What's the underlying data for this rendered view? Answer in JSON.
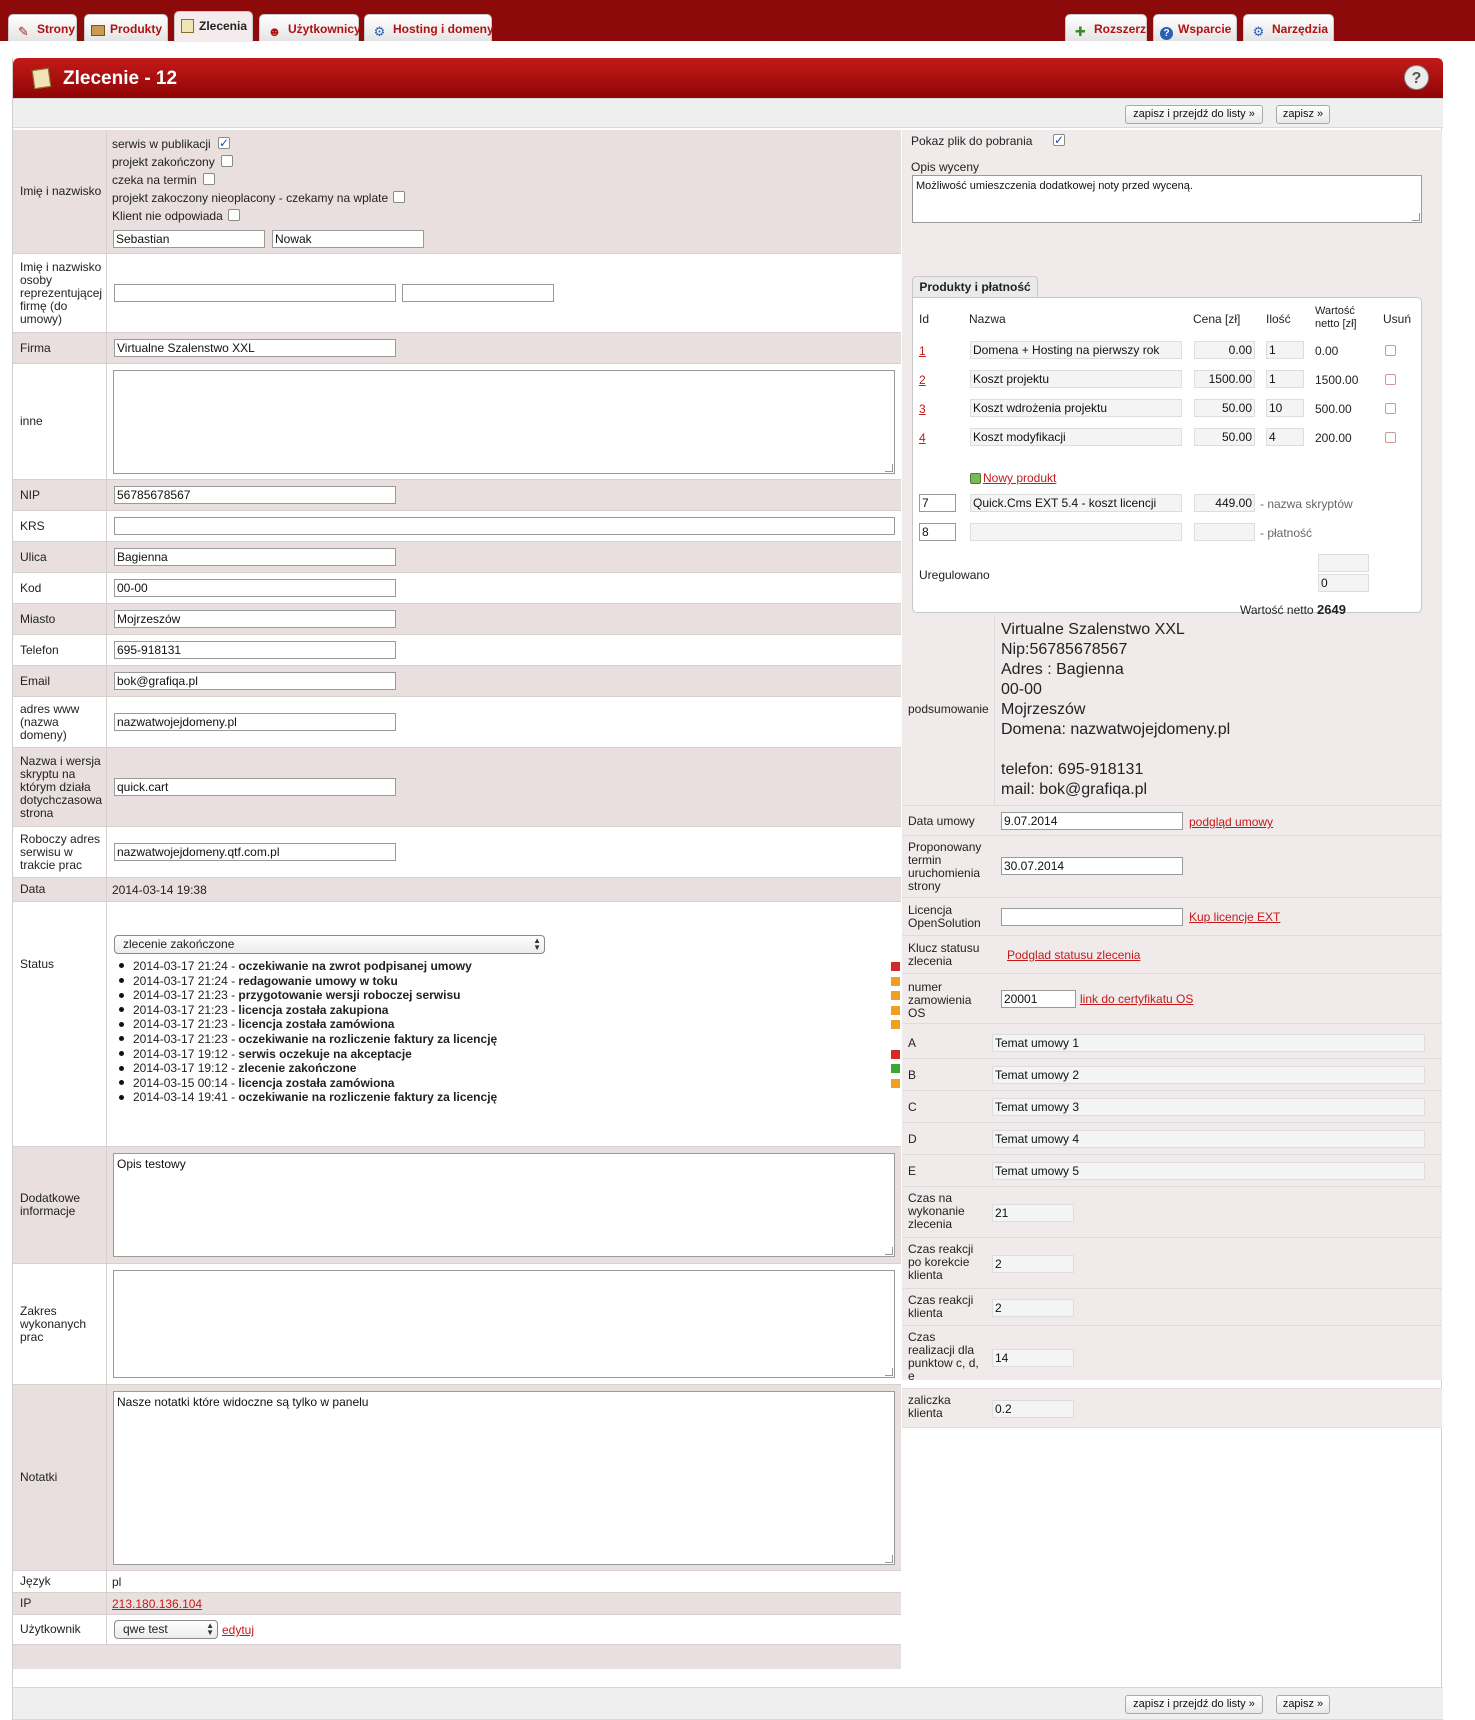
{
  "nav": {
    "tabs_left": [
      {
        "label": "Strony",
        "icon": "pencil-icon"
      },
      {
        "label": "Produkty",
        "icon": "box-icon"
      },
      {
        "label": "Zlecenia",
        "icon": "clipboard-icon"
      },
      {
        "label": "Użytkownicy",
        "icon": "user-icon"
      },
      {
        "label": "Hosting i domeny",
        "icon": "gears-icon"
      }
    ],
    "tabs_right": [
      {
        "label": "Rozszerz",
        "icon": "puzzle-icon"
      },
      {
        "label": "Wsparcie",
        "icon": "help-icon"
      },
      {
        "label": "Narzędzia",
        "icon": "gears-icon"
      }
    ],
    "active_tab": "Zlecenia"
  },
  "page": {
    "title": "Zlecenie - 12",
    "save_and_list": "zapisz i przejdź do listy »",
    "save": "zapisz »"
  },
  "left": {
    "name_label": "Imię i nazwisko",
    "checks": [
      {
        "label": "serwis w publikacji",
        "checked": true
      },
      {
        "label": "projekt zakończony",
        "checked": false
      },
      {
        "label": "czeka na termin",
        "checked": false
      },
      {
        "label": "projekt zakoczony nieoplacony - czekamy na wplate",
        "checked": false
      },
      {
        "label": "Klient nie odpowiada",
        "checked": false
      }
    ],
    "first_name": "Sebastian",
    "last_name": "Nowak",
    "rep_label": "Imię i nazwisko osoby reprezentującej firmę (do umowy)",
    "firma_label": "Firma",
    "firma": "Virtualne Szalenstwo XXL",
    "inne_label": "inne",
    "nip_label": "NIP",
    "nip": "56785678567",
    "krs_label": "KRS",
    "ulica_label": "Ulica",
    "ulica": "Bagienna",
    "kod_label": "Kod",
    "kod": "00-00",
    "miasto_label": "Miasto",
    "miasto": "Mojrzeszów",
    "telefon_label": "Telefon",
    "telefon": "695-918131",
    "email_label": "Email",
    "email": "bok@grafiqa.pl",
    "www_label": "adres www (nazwa domeny)",
    "www": "nazwatwojejdomeny.pl",
    "script_label": "Nazwa i wersja skryptu na którym działa dotychczasowa strona",
    "script": "quick.cart",
    "work_url_label": "Roboczy adres serwisu w trakcie prac",
    "work_url": "nazwatwojejdomeny.qtf.com.pl",
    "data_label": "Data",
    "data": "2014-03-14 19:38",
    "status_label": "Status",
    "status_value": "zlecenie zakończone",
    "status_history": [
      {
        "date": "2014-03-17 21:24",
        "text": "oczekiwanie na zwrot podpisanej umowy",
        "color": "#d42a2a"
      },
      {
        "date": "2014-03-17 21:24",
        "text": "redagowanie umowy w toku",
        "color": "#f0a020"
      },
      {
        "date": "2014-03-17 21:23",
        "text": "przygotowanie wersji roboczej serwisu",
        "color": "#f0a020"
      },
      {
        "date": "2014-03-17 21:23",
        "text": "licencja została zakupiona",
        "color": "#f0a020"
      },
      {
        "date": "2014-03-17 21:23",
        "text": "licencja została zamówiona",
        "color": "#f0a020"
      },
      {
        "date": "2014-03-17 21:23",
        "text": "oczekiwanie na rozliczenie faktury za licencję",
        "color": ""
      },
      {
        "date": "2014-03-17 19:12",
        "text": "serwis oczekuje na akceptacje",
        "color": "#d42a2a"
      },
      {
        "date": "2014-03-17 19:12",
        "text": "zlecenie zakończone",
        "color": "#3aa832"
      },
      {
        "date": "2014-03-15 00:14",
        "text": "licencja została zamówiona",
        "color": "#f0a020"
      },
      {
        "date": "2014-03-14 19:41",
        "text": "oczekiwanie na rozliczenie faktury za licencję",
        "color": ""
      }
    ],
    "extra_label": "Dodatkowe informacje",
    "extra": "Opis testowy",
    "scope_label": "Zakres wykonanych prac",
    "notes_label": "Notatki",
    "notes": "Nasze notatki które widoczne są tylko w panelu",
    "lang_label": "Język",
    "lang": "pl",
    "ip_label": "IP",
    "ip": "213.180.136.104",
    "user_label": "Użytkownik",
    "user": "qwe test",
    "edit": "edytuj"
  },
  "right": {
    "show_file_label": "Pokaz plik do pobrania",
    "show_file_checked": true,
    "valuation_label": "Opis wyceny",
    "valuation": "Możliwość umieszczenia dodatkowej noty przed wyceną.",
    "products_tab": "Produkty i płatność",
    "cols": {
      "id": "Id",
      "name": "Nazwa",
      "price": "Cena [zł]",
      "qty": "Ilość",
      "net": "Wartość netto [zł]",
      "del": "Usuń"
    },
    "products": [
      {
        "id": "1",
        "name": "Domena + Hosting  na pierwszy rok",
        "price": "0.00",
        "qty": "1",
        "net": "0.00"
      },
      {
        "id": "2",
        "name": "Koszt projektu",
        "price": "1500.00",
        "qty": "1",
        "net": "1500.00"
      },
      {
        "id": "3",
        "name": "Koszt wdrożenia projektu",
        "price": "50.00",
        "qty": "10",
        "net": "500.00"
      },
      {
        "id": "4",
        "name": "Koszt modyfikacji",
        "price": "50.00",
        "qty": "4",
        "net": "200.00"
      }
    ],
    "new_product": "Nowy produkt",
    "script_row": {
      "id": "7",
      "name": "Quick.Cms EXT 5.4 - koszt licencji",
      "price": "449.00",
      "note": "- nazwa skryptów"
    },
    "payment_row": {
      "id": "8",
      "name": "",
      "price": "",
      "note": "- płatność"
    },
    "settled_label": "Uregulowano",
    "settled": "0",
    "net_total_label": "Wartość netto",
    "net_total": "2649",
    "summary_label": "podsumowanie",
    "summary_lines": [
      "Virtualne Szalenstwo XXL",
      "Nip:56785678567",
      "Adres : Bagienna",
      "00-00",
      "Mojrzeszów",
      "Domena: nazwatwojejdomeny.pl",
      "",
      "telefon: 695-918131",
      "mail: bok@grafiqa.pl"
    ],
    "contract_date_label": "Data umowy",
    "contract_date": "9.07.2014",
    "contract_preview": "podgląd umowy",
    "launch_label": "Proponowany termin uruchomienia strony",
    "launch_date": "30.07.2014",
    "license_label": "Licencja OpenSolution",
    "buy_license": "Kup licencje EXT",
    "status_key_label": "Klucz statusu zlecenia",
    "status_preview": "Podglad statusu zlecenia",
    "order_no_label": "numer zamowienia OS",
    "order_no": "20001",
    "cert_link": "link do certyfikatu OS",
    "topics": [
      {
        "label": "A",
        "value": "Temat umowy 1"
      },
      {
        "label": "B",
        "value": "Temat umowy 2"
      },
      {
        "label": "C",
        "value": "Temat umowy 3"
      },
      {
        "label": "D",
        "value": "Temat umowy 4"
      },
      {
        "label": "E",
        "value": "Temat umowy 5"
      }
    ],
    "times": [
      {
        "label": "Czas na wykonanie zlecenia",
        "value": "21"
      },
      {
        "label": "Czas reakcji po korekcie klienta",
        "value": "2"
      },
      {
        "label": "Czas reakcji klienta",
        "value": "2"
      },
      {
        "label": "Czas realizacji dla punktow c, d, e",
        "value": "14"
      },
      {
        "label": "zaliczka klienta",
        "value": "0.2"
      }
    ]
  }
}
